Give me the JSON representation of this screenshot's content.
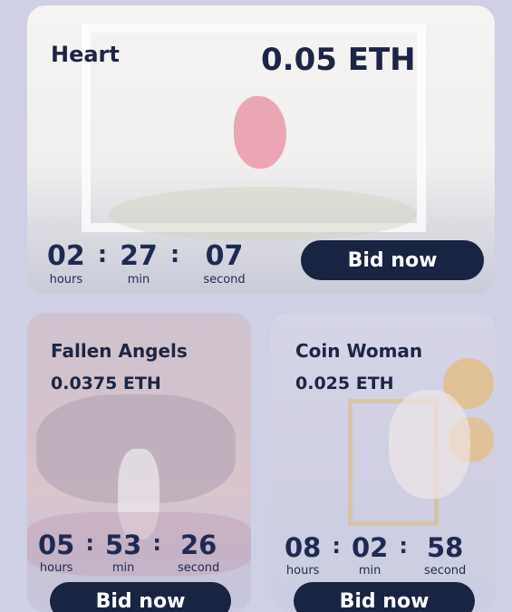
{
  "cards": [
    {
      "title": "Heart",
      "price": "0.05 ETH",
      "timer": {
        "hours": "02",
        "min": "27",
        "second": "07"
      },
      "bid_label": "Bid now"
    },
    {
      "title": "Fallen Angels",
      "price": "0.0375 ETH",
      "timer": {
        "hours": "05",
        "min": "53",
        "second": "26"
      },
      "bid_label": "Bid now"
    },
    {
      "title": "Coin Woman",
      "price": "0.025 ETH",
      "timer": {
        "hours": "08",
        "min": "02",
        "second": "58"
      },
      "bid_label": "Bid now"
    }
  ],
  "labels": {
    "hours": "hours",
    "min": "min",
    "second": "second",
    "sep": ":"
  },
  "colors": {
    "page_bg": "#cfcfe5",
    "button_bg": "#182442",
    "text": "#1d2544"
  }
}
